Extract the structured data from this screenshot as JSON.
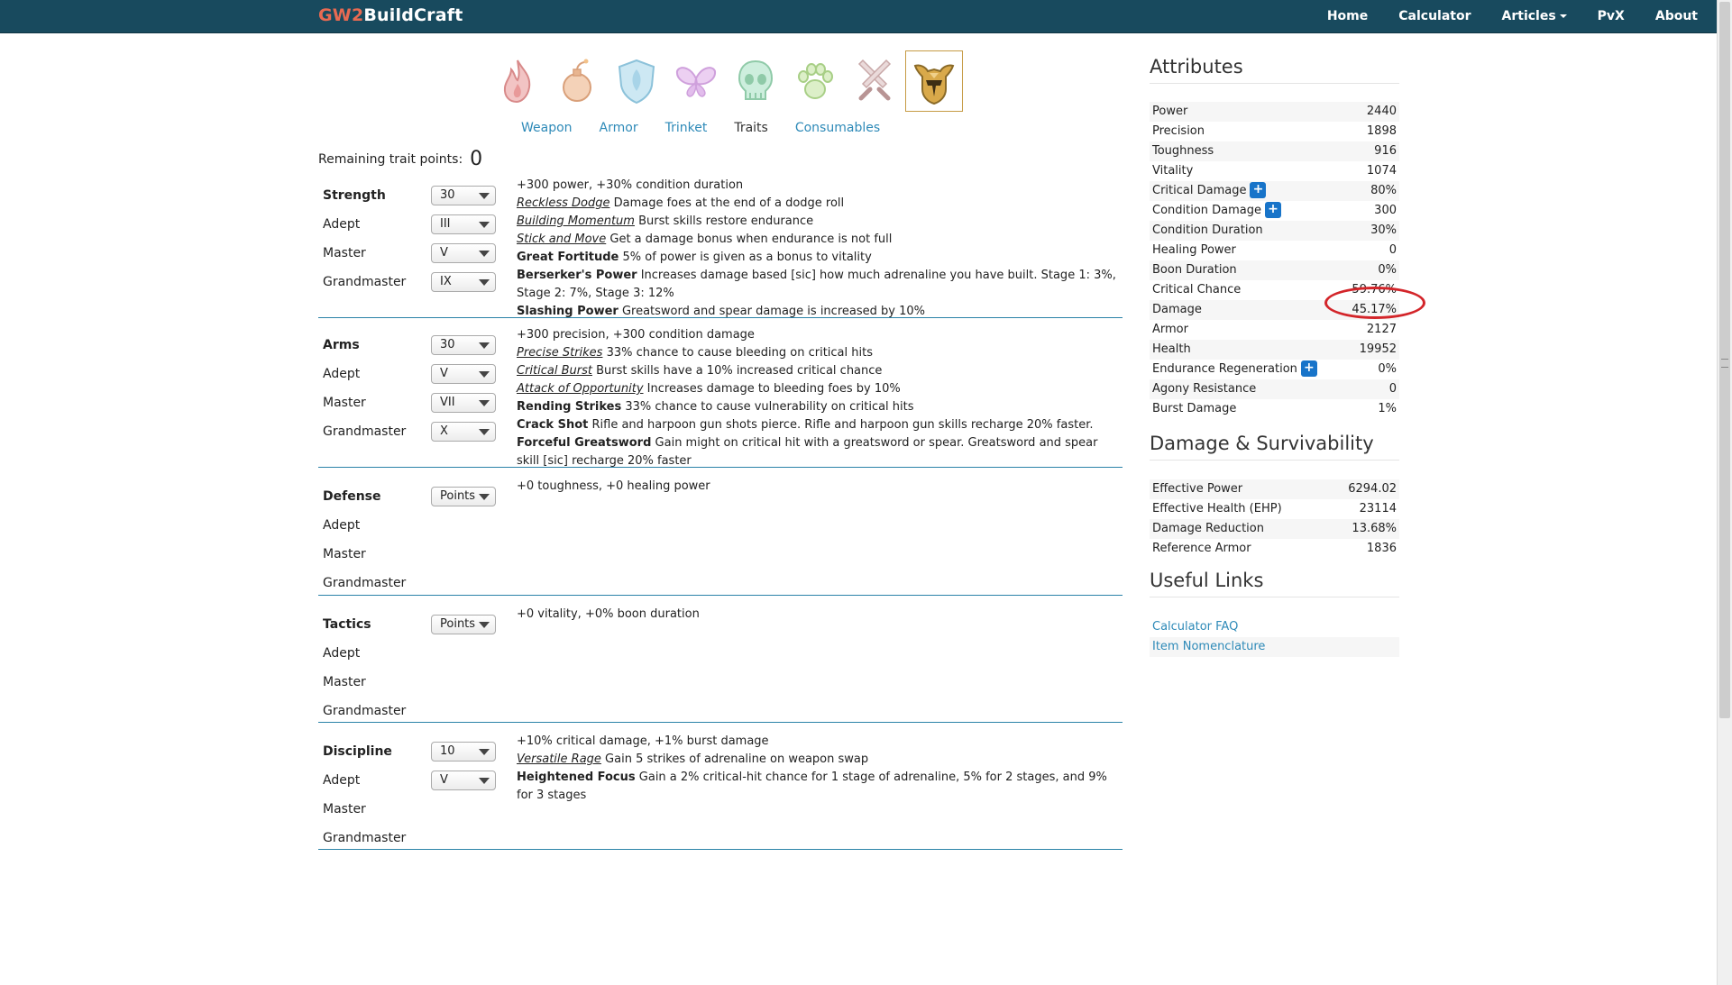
{
  "navbar": {
    "brand_prefix": "GW2",
    "brand_suffix": "BuildCraft",
    "items": [
      "Home",
      "Calculator",
      "Articles",
      "PvX",
      "About"
    ]
  },
  "professions": [
    {
      "name": "Elementalist",
      "icon": "flame-icon",
      "color": "#e8a0a0"
    },
    {
      "name": "Engineer",
      "icon": "bomb-icon",
      "color": "#e8b590"
    },
    {
      "name": "Guardian",
      "icon": "shield-icon",
      "color": "#a8d4e8"
    },
    {
      "name": "Mesmer",
      "icon": "butterfly-icon",
      "color": "#dca8e8"
    },
    {
      "name": "Necromancer",
      "icon": "skull-icon",
      "color": "#a8dcc0"
    },
    {
      "name": "Ranger",
      "icon": "paw-icon",
      "color": "#c2e0a8"
    },
    {
      "name": "Thief",
      "icon": "daggers-icon",
      "color": "#d4a8a8"
    },
    {
      "name": "Warrior",
      "icon": "helmet-icon",
      "color": "#c69b45",
      "selected": true
    }
  ],
  "subtabs": [
    "Weapon",
    "Armor",
    "Trinket",
    "Traits",
    "Consumables"
  ],
  "remaining": {
    "label": "Remaining trait points:",
    "value": "0"
  },
  "trait_lines": [
    {
      "name": "Strength",
      "points": "30",
      "rows": [
        {
          "label": "Adept",
          "value": "III"
        },
        {
          "label": "Master",
          "value": "V"
        },
        {
          "label": "Grandmaster",
          "value": "IX"
        }
      ],
      "desc": [
        {
          "text": "+300 power, +30% condition duration"
        },
        {
          "italic": "Reckless Dodge",
          "text": " Damage foes at the end of a dodge roll"
        },
        {
          "italic": "Building Momentum",
          "text": " Burst skills restore endurance"
        },
        {
          "italic": "Stick and Move",
          "text": " Get a damage bonus when endurance is not full"
        },
        {
          "bold": "Great Fortitude",
          "text": " 5% of power is given as a bonus to vitality"
        },
        {
          "bold": "Berserker's Power",
          "text": " Increases damage based [sic] how much adrenaline you have built. Stage 1: 3%, Stage 2: 7%, Stage 3: 12%"
        },
        {
          "bold": "Slashing Power",
          "text": " Greatsword and spear damage is increased by 10%"
        }
      ]
    },
    {
      "name": "Arms",
      "points": "30",
      "rows": [
        {
          "label": "Adept",
          "value": "V"
        },
        {
          "label": "Master",
          "value": "VII"
        },
        {
          "label": "Grandmaster",
          "value": "X"
        }
      ],
      "desc": [
        {
          "text": "+300 precision, +300 condition damage"
        },
        {
          "italic": "Precise Strikes",
          "text": " 33% chance to cause bleeding on critical hits"
        },
        {
          "italic": "Critical Burst",
          "text": " Burst skills have a 10% increased critical chance"
        },
        {
          "italic": "Attack of Opportunity",
          "text": " Increases damage to bleeding foes by 10%"
        },
        {
          "bold": "Rending Strikes",
          "text": " 33% chance to cause vulnerability on critical hits"
        },
        {
          "bold": "Crack Shot",
          "text": " Rifle and harpoon gun shots pierce. Rifle and harpoon gun skills recharge 20% faster."
        },
        {
          "bold": "Forceful Greatsword",
          "text": " Gain might on critical hit with a greatsword or spear. Greatsword and spear skill [sic] recharge 20% faster"
        }
      ]
    },
    {
      "name": "Defense",
      "points": "Points",
      "rows": [
        {
          "label": "Adept",
          "value": ""
        },
        {
          "label": "Master",
          "value": ""
        },
        {
          "label": "Grandmaster",
          "value": ""
        }
      ],
      "desc": [
        {
          "text": "+0 toughness, +0 healing power"
        }
      ]
    },
    {
      "name": "Tactics",
      "points": "Points",
      "rows": [
        {
          "label": "Adept",
          "value": ""
        },
        {
          "label": "Master",
          "value": ""
        },
        {
          "label": "Grandmaster",
          "value": ""
        }
      ],
      "desc": [
        {
          "text": "+0 vitality, +0% boon duration"
        }
      ]
    },
    {
      "name": "Discipline",
      "points": "10",
      "rows": [
        {
          "label": "Adept",
          "value": "V"
        },
        {
          "label": "Master",
          "value": ""
        },
        {
          "label": "Grandmaster",
          "value": ""
        }
      ],
      "desc": [
        {
          "text": "+10% critical damage, +1% burst damage"
        },
        {
          "italic": "Versatile Rage",
          "text": " Gain 5 strikes of adrenaline on weapon swap"
        },
        {
          "bold": "Heightened Focus",
          "text": " Gain a 2% critical-hit chance for 1 stage of adrenaline, 5% for 2 stages, and 9% for 3 stages"
        }
      ]
    }
  ],
  "attributes": {
    "title": "Attributes",
    "rows": [
      {
        "label": "Power",
        "value": "2440"
      },
      {
        "label": "Precision",
        "value": "1898"
      },
      {
        "label": "Toughness",
        "value": "916"
      },
      {
        "label": "Vitality",
        "value": "1074"
      },
      {
        "label": "Critical Damage",
        "value": "80%",
        "plus": true
      },
      {
        "label": "Condition Damage",
        "value": "300",
        "plus": true
      },
      {
        "label": "Condition Duration",
        "value": "30%"
      },
      {
        "label": "Healing Power",
        "value": "0"
      },
      {
        "label": "Boon Duration",
        "value": "0%"
      },
      {
        "label": "Critical Chance",
        "value": "59.76%",
        "highlight": true
      },
      {
        "label": "Damage",
        "value": "45.17%"
      },
      {
        "label": "Armor",
        "value": "2127"
      },
      {
        "label": "Health",
        "value": "19952"
      },
      {
        "label": "Endurance Regeneration",
        "value": "0%",
        "plus": true
      },
      {
        "label": "Agony Resistance",
        "value": "0"
      },
      {
        "label": "Burst Damage",
        "value": "1%"
      }
    ]
  },
  "survivability": {
    "title": "Damage & Survivability",
    "rows": [
      {
        "label": "Effective Power",
        "value": "6294.02"
      },
      {
        "label": "Effective Health (EHP)",
        "value": "23114"
      },
      {
        "label": "Damage Reduction",
        "value": "13.68%"
      },
      {
        "label": "Reference Armor",
        "value": "1836"
      }
    ]
  },
  "links": {
    "title": "Useful Links",
    "items": [
      "Calculator FAQ",
      "Item Nomenclature"
    ]
  },
  "plus_symbol": "+"
}
